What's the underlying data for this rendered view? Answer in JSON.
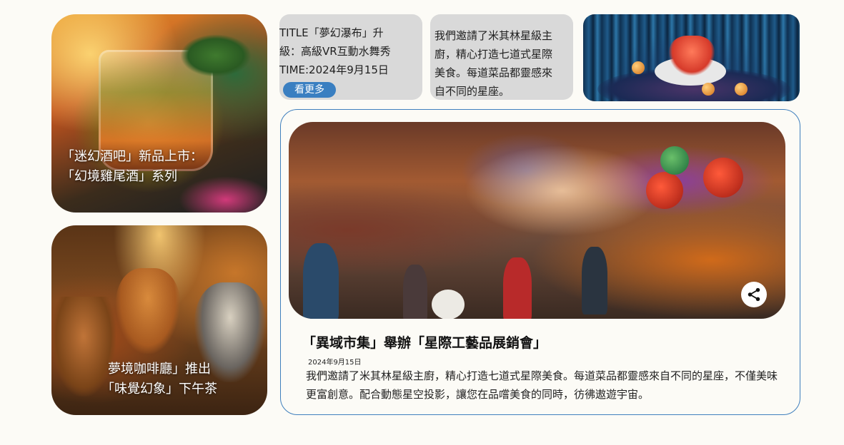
{
  "cards": {
    "cocktail": {
      "line1": "「迷幻酒吧」新品上市：",
      "line2": "「幻境雞尾酒」系列"
    },
    "cafe": {
      "line1": "夢境咖啡廳」推出",
      "line2": "「味覺幻象」下午茶"
    },
    "vr": {
      "title_line1": "TITLE「夢幻瀑布」升",
      "title_line2": "級：高級VR互動水舞秀",
      "time": "TIME:2024年9月15日",
      "more_label": "看更多"
    },
    "chef": {
      "line1": "我們邀請了米其林星級主",
      "line2": "廚，精心打造七道式星際",
      "line3": "美食。每道菜品都靈感來",
      "line4": "自不同的星座。"
    }
  },
  "feature": {
    "title": "「異域市集」舉辦「星際工藝品展銷會」",
    "date": "2024年9月15日",
    "desc": "我們邀請了米其林星級主廚，精心打造七道式星際美食。每道菜品都靈感來自不同的星座，不僅美味更富創意。配合動態星空投影，讓您在品嚐美食的同時，彷彿遨遊宇宙。",
    "share_icon": "share-icon"
  }
}
